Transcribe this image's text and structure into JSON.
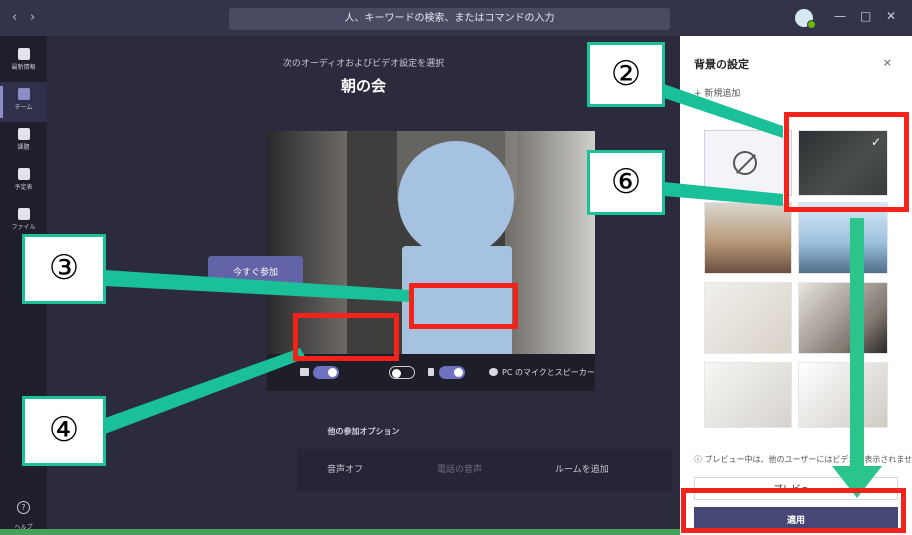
{
  "titlebar": {
    "search_placeholder": "人、キーワードの検索、またはコマンドの入力",
    "back": "‹",
    "forward": "›",
    "avatar": "2",
    "minimize": "—",
    "maximize": "□",
    "close": "✕"
  },
  "rail": {
    "items": [
      {
        "label": "最新情報",
        "icon": "bell-icon"
      },
      {
        "label": "チーム",
        "icon": "teams-icon"
      },
      {
        "label": "課題",
        "icon": "assignments-icon"
      },
      {
        "label": "予定表",
        "icon": "calendar-icon"
      },
      {
        "label": "ファイル",
        "icon": "file-icon"
      }
    ],
    "help_label": "ヘルプ",
    "help_icon_text": "?"
  },
  "join": {
    "subtitle": "次のオーディオおよびビデオ設定を選択",
    "meeting_title": "朝の会",
    "join_button": "今すぐ参加",
    "device_label": "PC のマイクとスピーカー",
    "camera_on": true,
    "blur_on": false,
    "mic_on": true
  },
  "other_options": {
    "title": "他の参加オプション",
    "audio_off": "音声オフ",
    "phone_audio": "電話の音声",
    "add_room": "ルームを追加"
  },
  "background_panel": {
    "title": "背景の設定",
    "close": "×",
    "add_new": "新規追加",
    "add_icon_text": "+",
    "selected_check": "✓",
    "info": "プレビュー中は、他のユーザーにはビデオは表示されません。",
    "info_icon_text": "ⓘ",
    "preview_button": "プレビュー",
    "apply_button": "適用"
  },
  "callouts": {
    "c2": "②",
    "c3": "③",
    "c4": "④",
    "c6": "⑥"
  },
  "colors": {
    "accent": "#6264a7",
    "highlight": "#f3231b",
    "callout_border": "#19c098",
    "arrow": "#2bc48a"
  }
}
